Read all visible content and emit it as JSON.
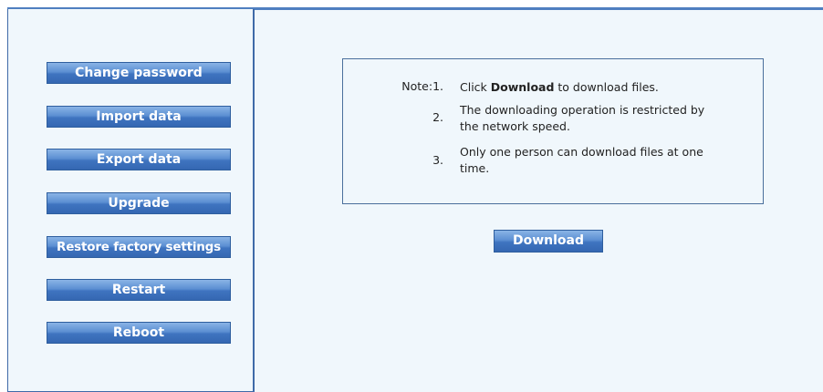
{
  "sidebar": {
    "buttons": [
      {
        "label": "Change password"
      },
      {
        "label": "Import data"
      },
      {
        "label": "Export data"
      },
      {
        "label": "Upgrade"
      },
      {
        "label": "Restore factory settings"
      },
      {
        "label": "Restart"
      },
      {
        "label": "Reboot"
      }
    ]
  },
  "note": {
    "prefix": "Note:1.",
    "items": [
      {
        "num": "",
        "pre": "Click ",
        "bold": "Download",
        "post": " to download files."
      },
      {
        "num": "2.",
        "text": "The downloading operation is restricted by the network speed."
      },
      {
        "num": "3.",
        "text": "Only one person can download files at one time."
      }
    ]
  },
  "download_button": {
    "label": "Download"
  },
  "colors": {
    "accent": "#3f74c0",
    "border": "#3f6aa8",
    "background": "#f0f7fc"
  }
}
